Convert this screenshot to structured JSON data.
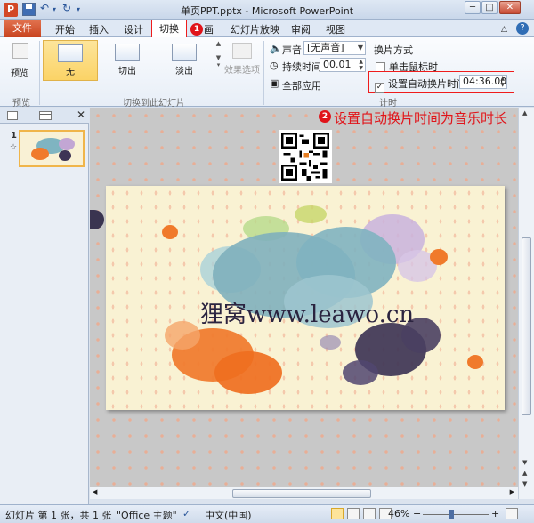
{
  "window": {
    "title": "单页PPT.pptx - Microsoft PowerPoint",
    "app_icon": "P",
    "minimize": "─",
    "maximize": "□",
    "close": "✕"
  },
  "qat": {
    "undo": "↶",
    "redo": "↻",
    "more": "▾"
  },
  "tabs": {
    "file": "文件",
    "items": [
      "开始",
      "插入",
      "设计",
      "切换",
      "动画",
      "幻灯片放映",
      "审阅",
      "视图"
    ],
    "active": "切换",
    "visible_anim_partial": "画",
    "badge1": "1"
  },
  "ribbon": {
    "preview_group": {
      "button": "预览",
      "label": "预览"
    },
    "transition_group": {
      "items": [
        "无",
        "切出",
        "淡出"
      ],
      "selected": "无",
      "effects_button": "效果选项",
      "label": "切换到此幻灯片"
    },
    "timing_group": {
      "sound_label": "声音:",
      "sound_value": "[无声音]",
      "duration_label": "持续时间:",
      "duration_value": "00.01",
      "apply_all": "全部应用",
      "advance_title": "换片方式",
      "on_click_label": "单击鼠标时",
      "on_click_checked": false,
      "after_label": "设置自动换片时间:",
      "after_checked": true,
      "after_value": "04:36.00",
      "label": "计时"
    }
  },
  "annotation": {
    "badge": "2",
    "text": "设置自动换片时间为音乐时长"
  },
  "slide_pane": {
    "slide_number": "1",
    "star": "☆"
  },
  "slide": {
    "watermark": "狸窝www.leawo.cn"
  },
  "statusbar": {
    "slide_info": "幻灯片 第 1 张，共 1 张",
    "theme": "\"Office 主题\"",
    "language": "中文(中国)",
    "zoom": "46%",
    "zoom_minus": "−",
    "zoom_plus": "+"
  }
}
